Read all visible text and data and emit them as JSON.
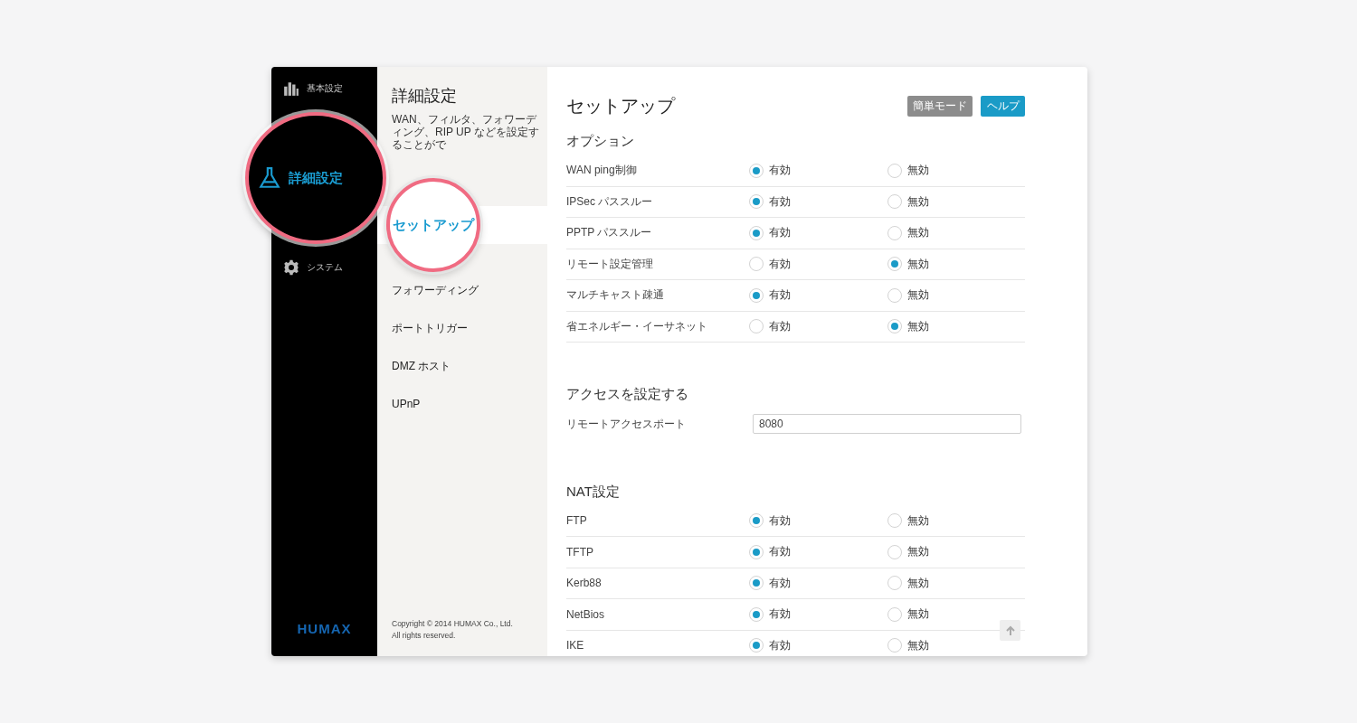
{
  "sidebar": {
    "items": [
      {
        "label": "基本設定",
        "selected": false
      },
      {
        "label": "詳細設定",
        "selected": true
      },
      {
        "label": "システム",
        "selected": false
      }
    ],
    "logo": "HUMAX"
  },
  "submenu": {
    "title": "詳細設定",
    "description": "WAN、フィルタ、フォワーディング、RIP UP などを設定することがで",
    "items": [
      {
        "label": "セットアップ",
        "selected": true
      },
      {
        "label": "フォワーディング",
        "selected": false
      },
      {
        "label": "ポートトリガー",
        "selected": false
      },
      {
        "label": "DMZ ホスト",
        "selected": false
      },
      {
        "label": "UPnP",
        "selected": false
      }
    ],
    "copyright": "Copyright © 2014 HUMAX Co., Ltd.",
    "rights": "All rights reserved."
  },
  "content": {
    "title": "セットアップ",
    "buttons": [
      {
        "label": "簡単モード",
        "kind": "secondary"
      },
      {
        "label": "ヘルプ",
        "kind": "primary"
      }
    ],
    "sections": [
      {
        "heading": "オプション",
        "kind": "radio",
        "rows": [
          {
            "label": "WAN ping制御",
            "options": [
              {
                "label": "有効",
                "selected": true
              },
              {
                "label": "無効",
                "selected": false
              }
            ]
          },
          {
            "label": "IPSec パススルー",
            "options": [
              {
                "label": "有効",
                "selected": true
              },
              {
                "label": "無効",
                "selected": false
              }
            ]
          },
          {
            "label": "PPTP パススルー",
            "options": [
              {
                "label": "有効",
                "selected": true
              },
              {
                "label": "無効",
                "selected": false
              }
            ]
          },
          {
            "label": "リモート設定管理",
            "options": [
              {
                "label": "有効",
                "selected": false
              },
              {
                "label": "無効",
                "selected": true
              }
            ]
          },
          {
            "label": "マルチキャスト疎通",
            "options": [
              {
                "label": "有効",
                "selected": true
              },
              {
                "label": "無効",
                "selected": false
              }
            ]
          },
          {
            "label": "省エネルギー・イーサネット",
            "options": [
              {
                "label": "有効",
                "selected": false
              },
              {
                "label": "無効",
                "selected": true
              }
            ]
          }
        ]
      },
      {
        "heading": "アクセスを設定する",
        "kind": "field",
        "rows": [
          {
            "label": "リモートアクセスポート",
            "value": "8080"
          }
        ]
      },
      {
        "heading": "NAT設定",
        "kind": "radio",
        "rows": [
          {
            "label": "FTP",
            "options": [
              {
                "label": "有効",
                "selected": true
              },
              {
                "label": "無効",
                "selected": false
              }
            ]
          },
          {
            "label": "TFTP",
            "options": [
              {
                "label": "有効",
                "selected": true
              },
              {
                "label": "無効",
                "selected": false
              }
            ]
          },
          {
            "label": "Kerb88",
            "options": [
              {
                "label": "有効",
                "selected": true
              },
              {
                "label": "無効",
                "selected": false
              }
            ]
          },
          {
            "label": "NetBios",
            "options": [
              {
                "label": "有効",
                "selected": true
              },
              {
                "label": "無効",
                "selected": false
              }
            ]
          },
          {
            "label": "IKE",
            "options": [
              {
                "label": "有効",
                "selected": true
              },
              {
                "label": "無効",
                "selected": false
              }
            ]
          }
        ]
      }
    ]
  }
}
